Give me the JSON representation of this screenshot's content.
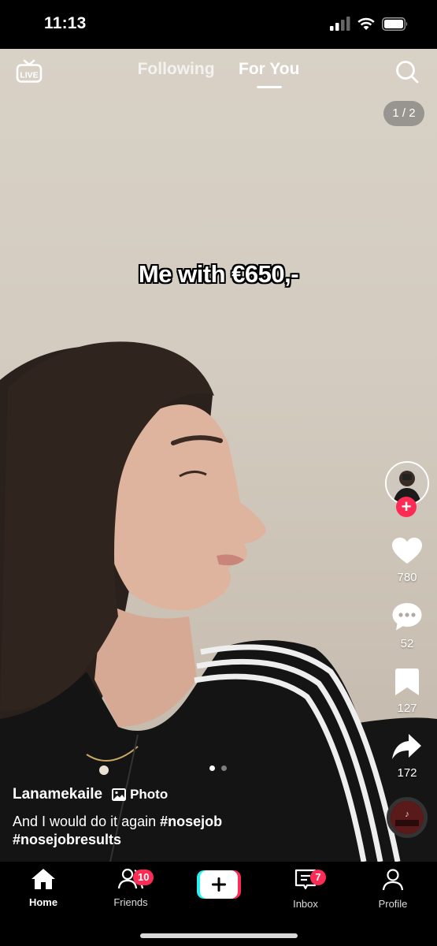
{
  "status_bar": {
    "time": "11:13"
  },
  "top_nav": {
    "live_label": "LIVE",
    "tabs": [
      {
        "label": "Following"
      },
      {
        "label": "For You"
      }
    ],
    "active_tab": "For You",
    "page_counter": "1 / 2"
  },
  "overlay_caption": "Me with €650,-",
  "actions": {
    "likes": "780",
    "comments": "52",
    "saves": "127",
    "shares": "172"
  },
  "carousel": {
    "current": 1,
    "total": 2
  },
  "post": {
    "username": "Lanamekaile",
    "type_label": "Photo",
    "description": "And I would do it again",
    "hashtags": [
      "#nosejob",
      "#nosejobresults"
    ]
  },
  "bottom_nav": {
    "items": [
      {
        "label": "Home",
        "badge": ""
      },
      {
        "label": "Friends",
        "badge": "10"
      },
      {
        "label": "",
        "badge": ""
      },
      {
        "label": "Inbox",
        "badge": "7"
      },
      {
        "label": "Profile",
        "badge": ""
      }
    ]
  },
  "colors": {
    "accent_red": "#fe2c55",
    "accent_cyan": "#25f4ee",
    "background": "#000000"
  }
}
